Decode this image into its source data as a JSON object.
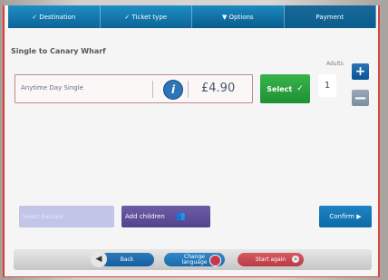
{
  "steps": [
    {
      "label": "✓ Destination"
    },
    {
      "label": "✓ Ticket type"
    },
    {
      "label": "▼ Options"
    },
    {
      "label": "Payment"
    }
  ],
  "journey_title": "Single to Canary Wharf",
  "adults_label": "Adults",
  "adults_count": "1",
  "ticket": {
    "name": "Anytime Day Single",
    "price": "£4.90",
    "info_symbol": "i",
    "select_label": "Select",
    "select_tick": "✓"
  },
  "buttons": {
    "plus": "+",
    "minus": "−",
    "select_railcard": "Select Railcard",
    "add_children": "Add children",
    "confirm": "Confirm ▶",
    "back": "Back",
    "back_arrow": "◀",
    "change_language": "Change\nlanguage",
    "start_again": "Start again"
  },
  "colors": {
    "step_bar": "#0f6fa0",
    "select": "#2aa640",
    "info": "#2e74b6",
    "confirm": "#1675b5",
    "add_children": "#5f4e99",
    "start_again": "#c84a51"
  },
  "icons": {
    "info": "info-icon",
    "children": "people-icon",
    "back": "back-arrow-icon",
    "flag": "uk-flag-icon",
    "home": "home-icon"
  }
}
